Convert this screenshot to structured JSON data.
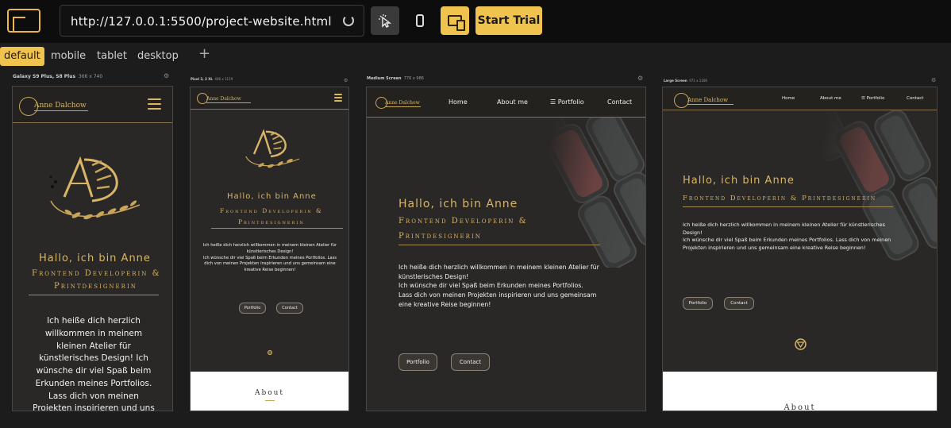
{
  "toolbar": {
    "url": "http://127.0.0.1:5500/project-website.html",
    "start_trial": "Start Trial",
    "accent": "#f0c24e"
  },
  "tabs": {
    "items": [
      "default",
      "mobile",
      "tablet",
      "desktop"
    ],
    "active": "default",
    "add": "+"
  },
  "devices": {
    "galaxy": {
      "name": "Galaxy S9 Plus, S8 Plus",
      "size": "366 x 740"
    },
    "pixel": {
      "name": "Pixel 3, 3 XL",
      "size": "406 x 1119"
    },
    "medium": {
      "name": "Medium Screen",
      "size": "776 x 986"
    },
    "large": {
      "name": "Large Screen",
      "size": "971 x 1166"
    }
  },
  "site": {
    "brand": "Anne Dalchow",
    "nav": {
      "home": "Home",
      "about": "About me",
      "portfolio": "☰ Portfolio",
      "contact": "Contact"
    },
    "hello": "Hallo, ich bin Anne",
    "role_line1": "Frontend Developerin &",
    "role_line2": "Printdesignerin",
    "role_full": "Frontend Developerin & Printdesignerin",
    "intro_mobile": "Ich heiße dich herzlich willkommen in meinem kleinen Atelier für künstlerisches Design! Ich wünsche dir viel Spaß beim Erkunden meines Portfolios. Lass dich von meinen Projekten inspirieren und uns gemeinsam",
    "intro_pixel": "Ich heiße dich herzlich willkommen in meinem kleinen Atelier für künstlerisches Design!\nIch wünsche dir viel Spaß beim Erkunden meines Portfolios. Lass dich von meinen Projekten inspirieren und uns gemeinsam eine kreative Reise beginnen!",
    "intro_medium": "Ich heiße dich herzlich willkommen in meinem kleinen Atelier für künstlerisches Design!\nIch wünsche dir viel Spaß beim Erkunden meines Portfolios.\nLass dich von meinen Projekten inspirieren und uns gemeinsam eine kreative Reise beginnen!",
    "intro_large": "Ich heiße dich herzlich willkommen in meinem kleinen Atelier für künstlerisches Design!\nIch wünsche dir viel Spaß beim Erkunden meines Portfolios. Lass dich von meinen Projekten inspirieren und uns gemeinsam eine kreative Reise beginnen!",
    "btn_portfolio": "Portfolio",
    "btn_contact": "Contact",
    "about": "About",
    "gold": "#d8b567"
  }
}
